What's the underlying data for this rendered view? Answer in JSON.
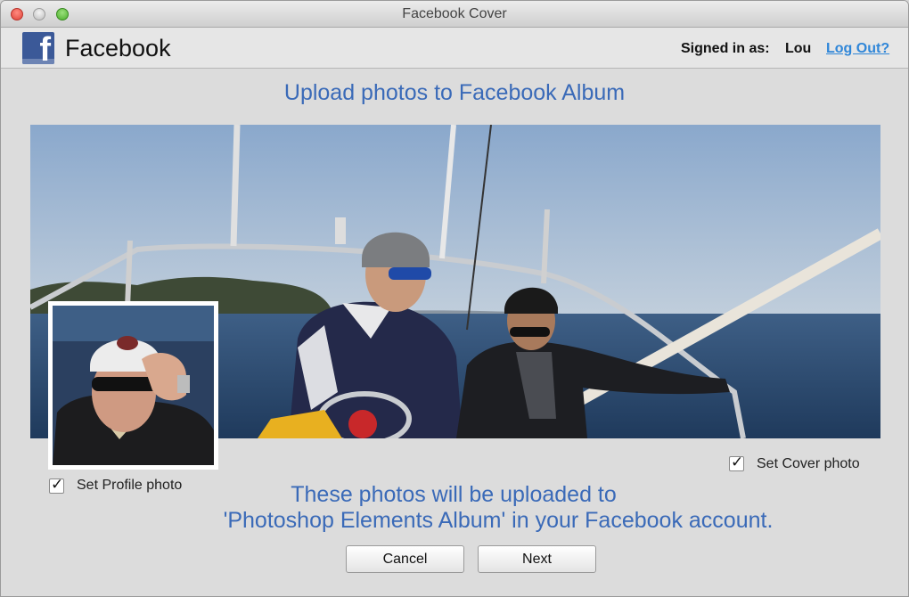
{
  "window": {
    "title": "Facebook Cover"
  },
  "header": {
    "brand": "Facebook",
    "signed_in_label": "Signed in as:",
    "user": "Lou",
    "logout_label": "Log Out?"
  },
  "main": {
    "heading": "Upload photos to Facebook Album",
    "cover_photo": {
      "checked": true,
      "label": "Set Cover photo"
    },
    "profile_photo": {
      "checked": true,
      "label": "Set Profile photo"
    },
    "notice_line1": "These photos will be uploaded to",
    "notice_line2": "'Photoshop Elements Album' in your Facebook account."
  },
  "buttons": {
    "cancel_label": "Cancel",
    "next_label": "Next"
  },
  "colors": {
    "accent_blue": "#3a6ab8",
    "link_blue": "#2f86d8",
    "facebook_blue": "#3b5998"
  }
}
